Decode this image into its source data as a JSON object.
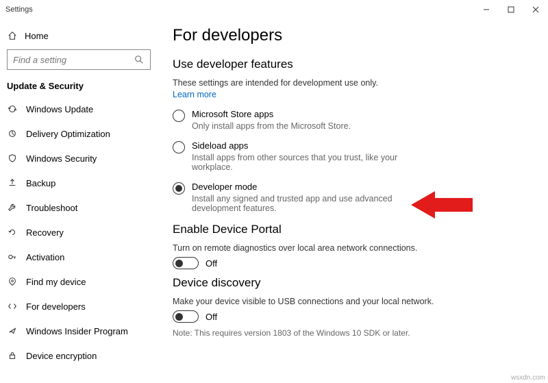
{
  "window": {
    "title": "Settings"
  },
  "sidebar": {
    "home": "Home",
    "search_placeholder": "Find a setting",
    "section": "Update & Security",
    "items": [
      {
        "label": "Windows Update"
      },
      {
        "label": "Delivery Optimization"
      },
      {
        "label": "Windows Security"
      },
      {
        "label": "Backup"
      },
      {
        "label": "Troubleshoot"
      },
      {
        "label": "Recovery"
      },
      {
        "label": "Activation"
      },
      {
        "label": "Find my device"
      },
      {
        "label": "For developers"
      },
      {
        "label": "Windows Insider Program"
      },
      {
        "label": "Device encryption"
      }
    ]
  },
  "main": {
    "heading": "For developers",
    "section1": {
      "title": "Use developer features",
      "desc": "These settings are intended for development use only.",
      "learn": "Learn more",
      "options": [
        {
          "title": "Microsoft Store apps",
          "sub": "Only install apps from the Microsoft Store.",
          "selected": false
        },
        {
          "title": "Sideload apps",
          "sub": "Install apps from other sources that you trust, like your workplace.",
          "selected": false
        },
        {
          "title": "Developer mode",
          "sub": "Install any signed and trusted app and use advanced development features.",
          "selected": true
        }
      ]
    },
    "section2": {
      "title": "Enable Device Portal",
      "desc": "Turn on remote diagnostics over local area network connections.",
      "toggle_state": "Off"
    },
    "section3": {
      "title": "Device discovery",
      "desc": "Make your device visible to USB connections and your local network.",
      "toggle_state": "Off",
      "note": "Note: This requires version 1803 of the Windows 10 SDK or later."
    }
  },
  "watermark": "wsxdn.com"
}
